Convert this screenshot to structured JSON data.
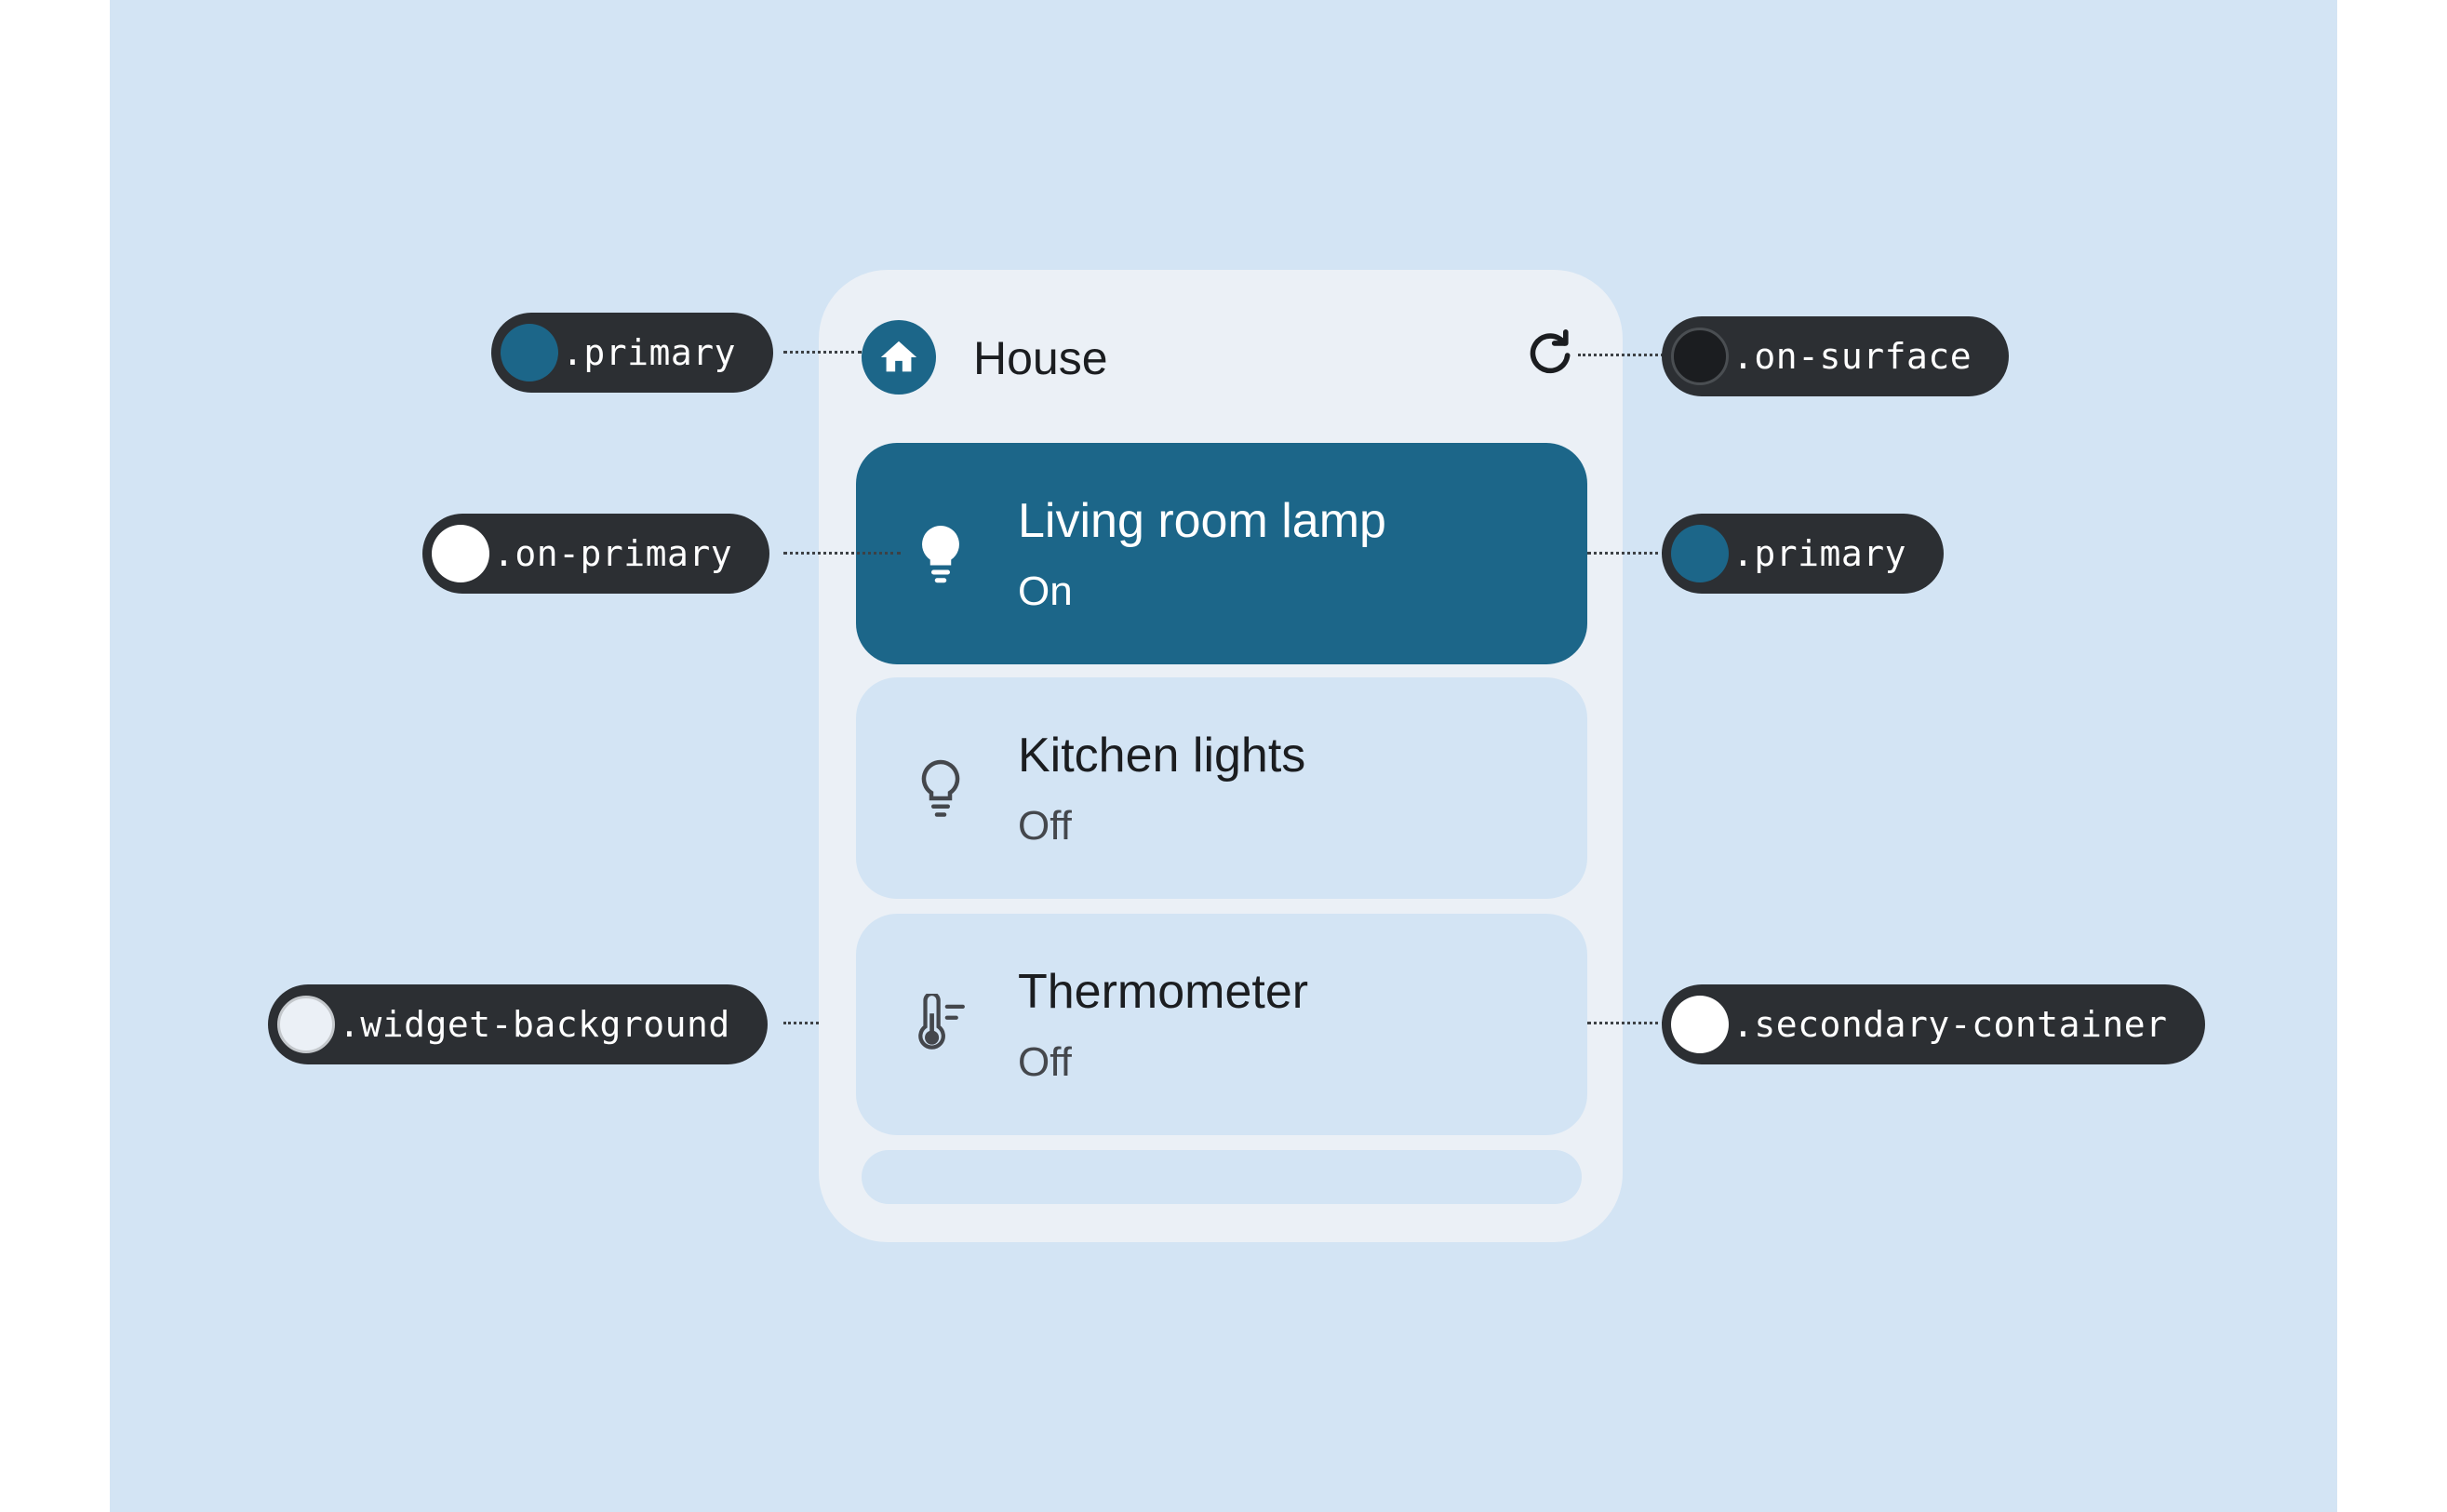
{
  "colors": {
    "primary": "#1c6689",
    "on_primary": "#ffffff",
    "on_surface": "#1b1d20",
    "widget_background": "#ebf0f6",
    "secondary_container": "#d3e4f4",
    "chip_background": "#2c2f33"
  },
  "widget": {
    "title": "House",
    "header_icon": "home-icon",
    "action_icon": "refresh-icon",
    "items": [
      {
        "title": "Living room lamp",
        "status": "On",
        "icon": "lightbulb-filled-icon",
        "active": true
      },
      {
        "title": "Kitchen lights",
        "status": "Off",
        "icon": "lightbulb-outline-icon",
        "active": false
      },
      {
        "title": "Thermometer",
        "status": "Off",
        "icon": "thermostat-icon",
        "active": false
      }
    ]
  },
  "annotations": {
    "header_icon": ".primary",
    "action_icon": ".on-surface",
    "active_icon": ".on-primary",
    "active_row": ".primary",
    "background": ".widget-background",
    "row_container": ".secondary-container"
  }
}
